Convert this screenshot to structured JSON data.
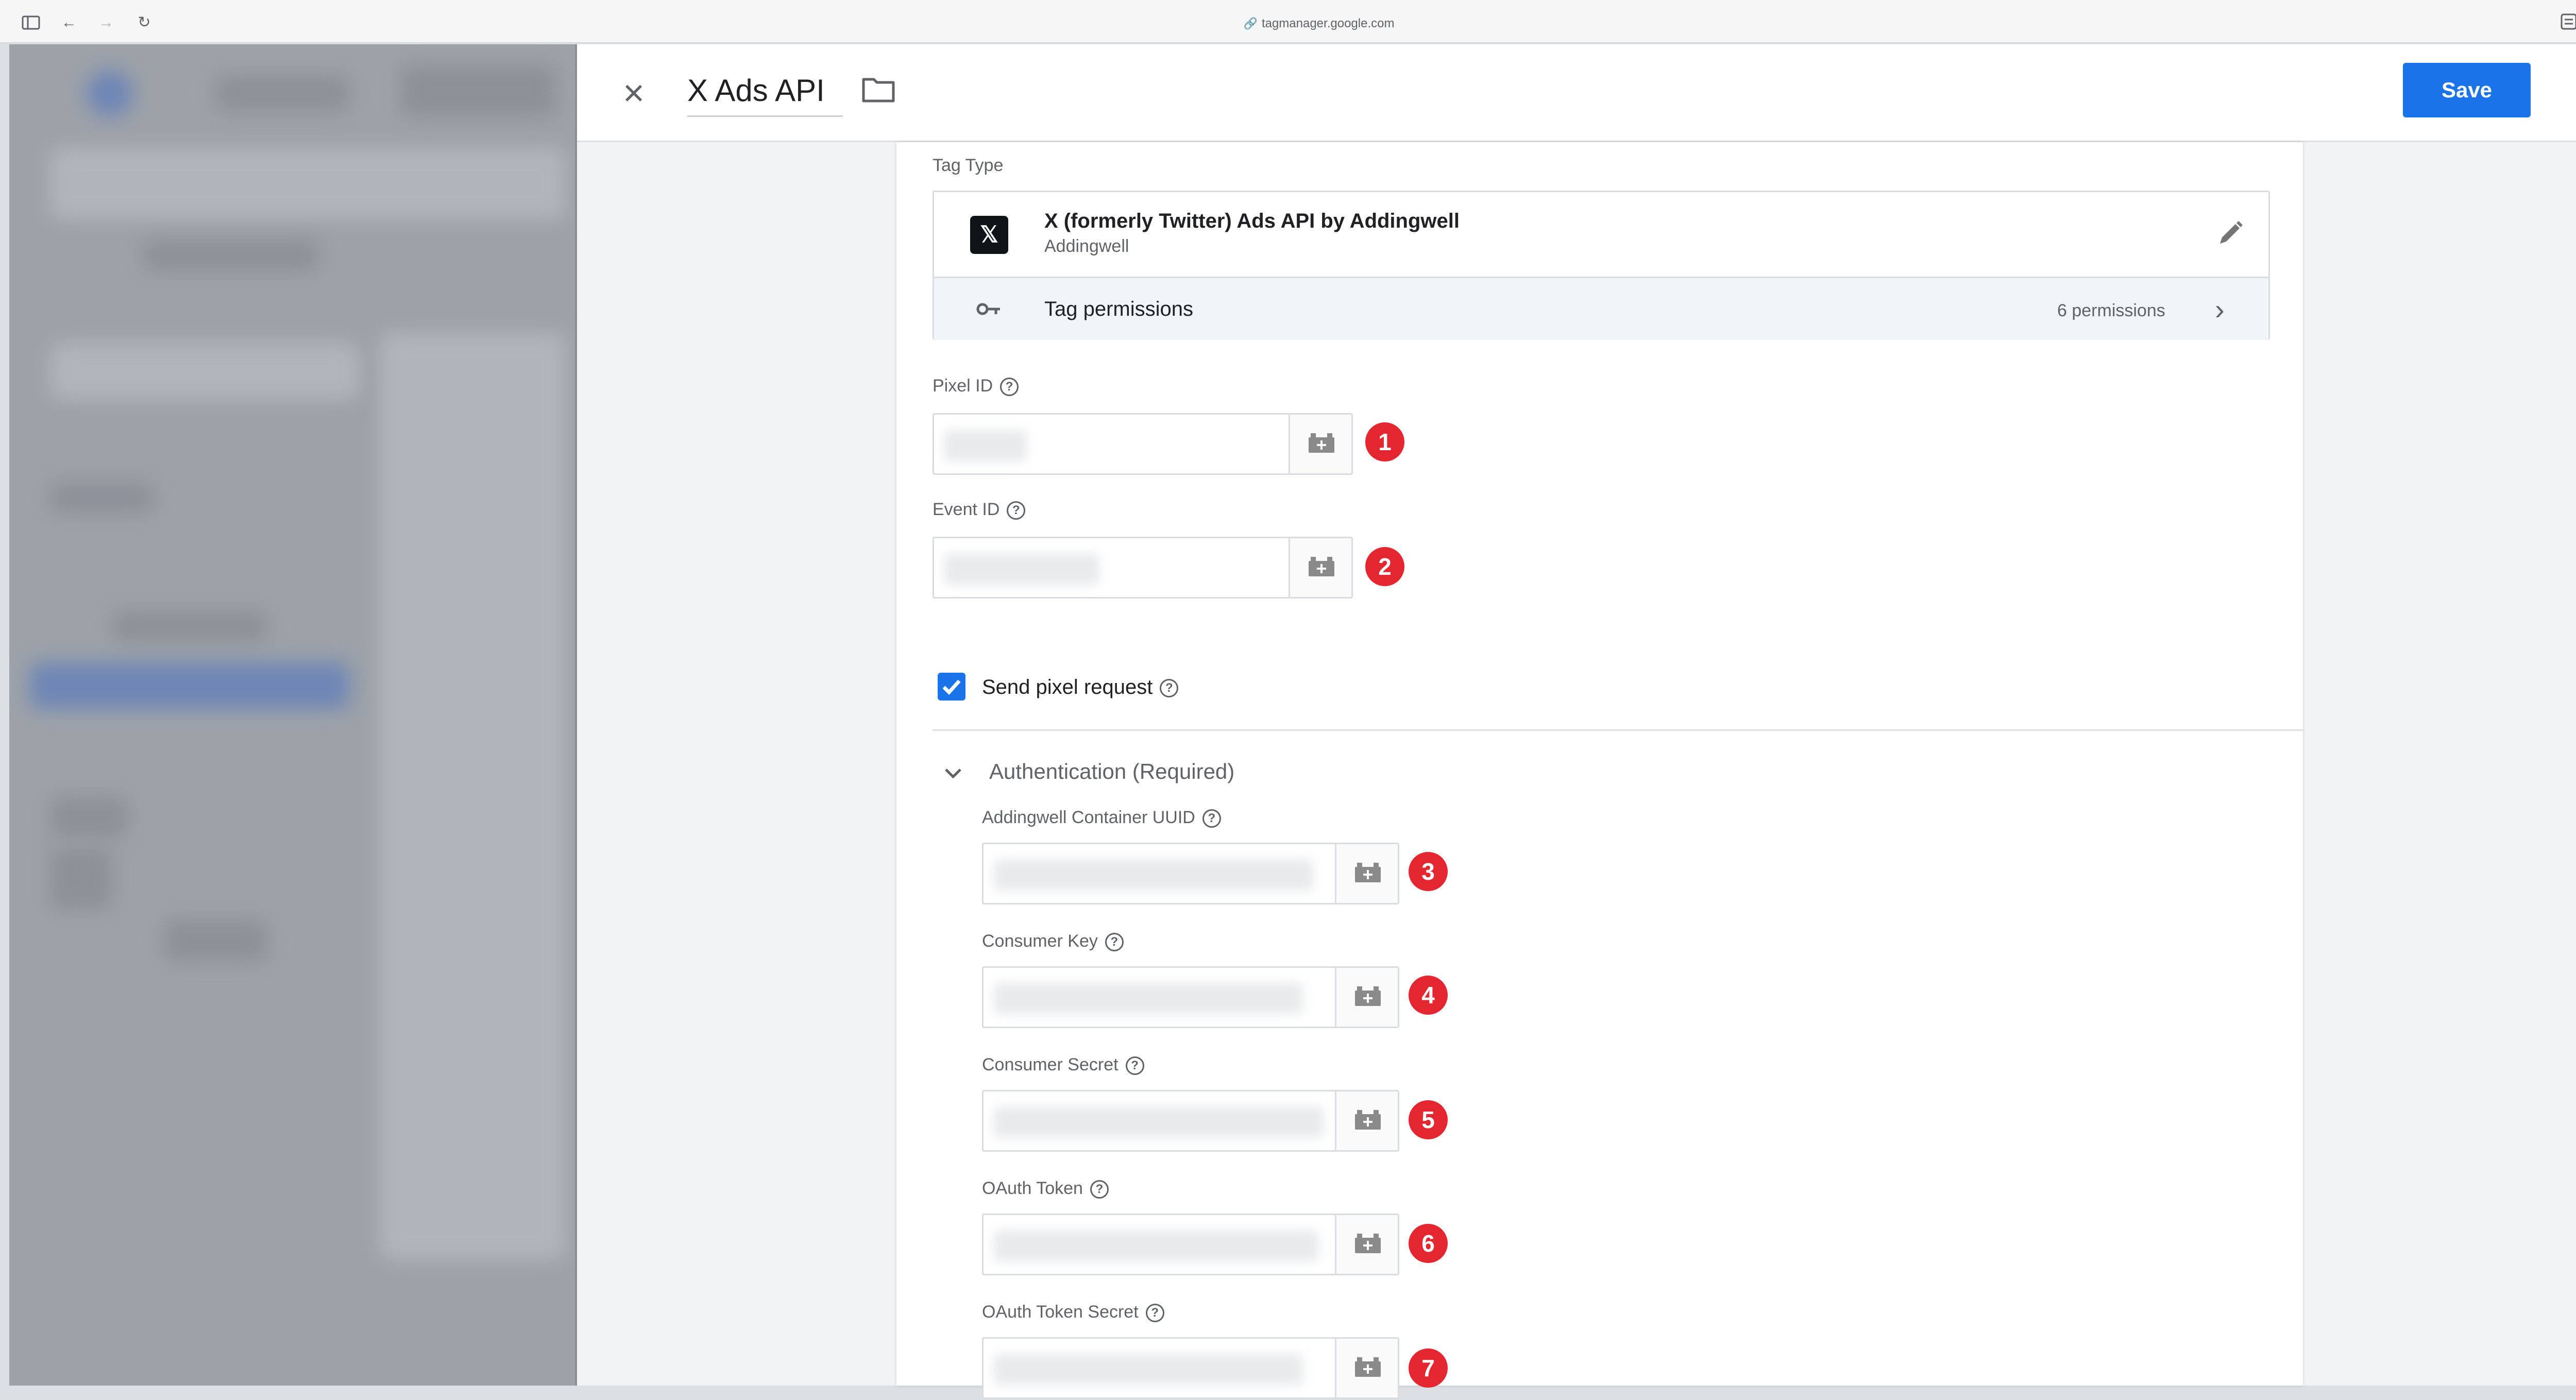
{
  "browser": {
    "url": "tagmanager.google.com"
  },
  "header": {
    "tag_name": "X Ads API",
    "save_label": "Save"
  },
  "tag_type": {
    "section_label": "Tag Type",
    "name": "X (formerly Twitter) Ads API by Addingwell",
    "vendor": "Addingwell",
    "permissions_label": "Tag permissions",
    "permissions_count": "6 permissions"
  },
  "fields": {
    "pixel_id": {
      "label": "Pixel ID",
      "badge": "1"
    },
    "event_id": {
      "label": "Event ID",
      "badge": "2"
    }
  },
  "send_pixel": {
    "label": "Send pixel request",
    "checked": true
  },
  "auth": {
    "title": "Authentication (Required)",
    "container_uuid": {
      "label": "Addingwell Container UUID",
      "badge": "3"
    },
    "consumer_key": {
      "label": "Consumer Key",
      "badge": "4"
    },
    "consumer_secret": {
      "label": "Consumer Secret",
      "badge": "5"
    },
    "oauth_token": {
      "label": "OAuth Token",
      "badge": "6"
    },
    "oauth_token_secret": {
      "label": "OAuth Token Secret",
      "badge": "7"
    }
  },
  "colors": {
    "accent": "#1a73e8",
    "badge": "#e3262f"
  }
}
